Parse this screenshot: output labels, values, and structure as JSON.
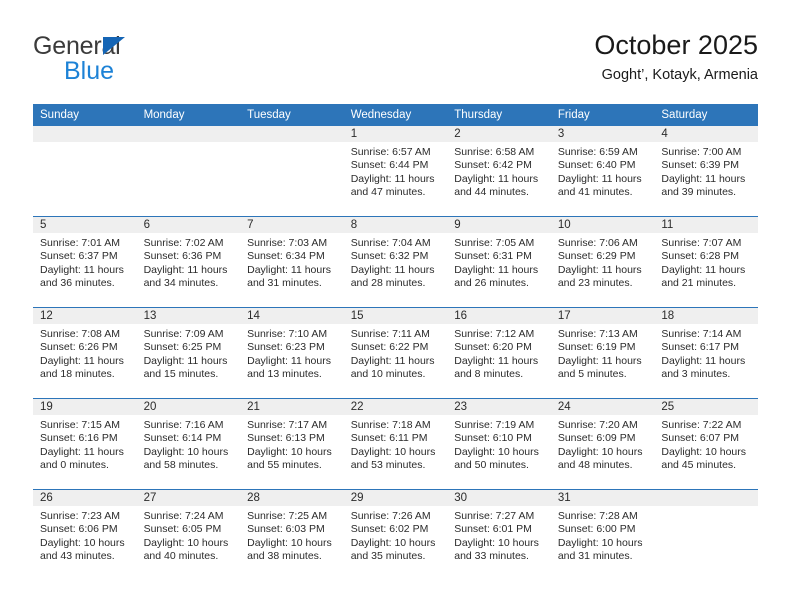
{
  "brand": {
    "line1": "General",
    "line2": "Blue",
    "triangle_color": "#1565b5",
    "blue_text_color": "#1d82d6"
  },
  "header": {
    "title": "October 2025",
    "subtitle": "Goght’, Kotayk, Armenia",
    "header_bg": "#2d75b9",
    "header_text": "#ffffff",
    "daynum_band": "#efefef"
  },
  "weekday_headers": [
    "Sunday",
    "Monday",
    "Tuesday",
    "Wednesday",
    "Thursday",
    "Friday",
    "Saturday"
  ],
  "weeks": [
    [
      {
        "day": "",
        "sunrise": "",
        "sunset": "",
        "daylight1": "",
        "daylight2": ""
      },
      {
        "day": "",
        "sunrise": "",
        "sunset": "",
        "daylight1": "",
        "daylight2": ""
      },
      {
        "day": "",
        "sunrise": "",
        "sunset": "",
        "daylight1": "",
        "daylight2": ""
      },
      {
        "day": "1",
        "sunrise": "Sunrise: 6:57 AM",
        "sunset": "Sunset: 6:44 PM",
        "daylight1": "Daylight: 11 hours",
        "daylight2": "and 47 minutes."
      },
      {
        "day": "2",
        "sunrise": "Sunrise: 6:58 AM",
        "sunset": "Sunset: 6:42 PM",
        "daylight1": "Daylight: 11 hours",
        "daylight2": "and 44 minutes."
      },
      {
        "day": "3",
        "sunrise": "Sunrise: 6:59 AM",
        "sunset": "Sunset: 6:40 PM",
        "daylight1": "Daylight: 11 hours",
        "daylight2": "and 41 minutes."
      },
      {
        "day": "4",
        "sunrise": "Sunrise: 7:00 AM",
        "sunset": "Sunset: 6:39 PM",
        "daylight1": "Daylight: 11 hours",
        "daylight2": "and 39 minutes."
      }
    ],
    [
      {
        "day": "5",
        "sunrise": "Sunrise: 7:01 AM",
        "sunset": "Sunset: 6:37 PM",
        "daylight1": "Daylight: 11 hours",
        "daylight2": "and 36 minutes."
      },
      {
        "day": "6",
        "sunrise": "Sunrise: 7:02 AM",
        "sunset": "Sunset: 6:36 PM",
        "daylight1": "Daylight: 11 hours",
        "daylight2": "and 34 minutes."
      },
      {
        "day": "7",
        "sunrise": "Sunrise: 7:03 AM",
        "sunset": "Sunset: 6:34 PM",
        "daylight1": "Daylight: 11 hours",
        "daylight2": "and 31 minutes."
      },
      {
        "day": "8",
        "sunrise": "Sunrise: 7:04 AM",
        "sunset": "Sunset: 6:32 PM",
        "daylight1": "Daylight: 11 hours",
        "daylight2": "and 28 minutes."
      },
      {
        "day": "9",
        "sunrise": "Sunrise: 7:05 AM",
        "sunset": "Sunset: 6:31 PM",
        "daylight1": "Daylight: 11 hours",
        "daylight2": "and 26 minutes."
      },
      {
        "day": "10",
        "sunrise": "Sunrise: 7:06 AM",
        "sunset": "Sunset: 6:29 PM",
        "daylight1": "Daylight: 11 hours",
        "daylight2": "and 23 minutes."
      },
      {
        "day": "11",
        "sunrise": "Sunrise: 7:07 AM",
        "sunset": "Sunset: 6:28 PM",
        "daylight1": "Daylight: 11 hours",
        "daylight2": "and 21 minutes."
      }
    ],
    [
      {
        "day": "12",
        "sunrise": "Sunrise: 7:08 AM",
        "sunset": "Sunset: 6:26 PM",
        "daylight1": "Daylight: 11 hours",
        "daylight2": "and 18 minutes."
      },
      {
        "day": "13",
        "sunrise": "Sunrise: 7:09 AM",
        "sunset": "Sunset: 6:25 PM",
        "daylight1": "Daylight: 11 hours",
        "daylight2": "and 15 minutes."
      },
      {
        "day": "14",
        "sunrise": "Sunrise: 7:10 AM",
        "sunset": "Sunset: 6:23 PM",
        "daylight1": "Daylight: 11 hours",
        "daylight2": "and 13 minutes."
      },
      {
        "day": "15",
        "sunrise": "Sunrise: 7:11 AM",
        "sunset": "Sunset: 6:22 PM",
        "daylight1": "Daylight: 11 hours",
        "daylight2": "and 10 minutes."
      },
      {
        "day": "16",
        "sunrise": "Sunrise: 7:12 AM",
        "sunset": "Sunset: 6:20 PM",
        "daylight1": "Daylight: 11 hours",
        "daylight2": "and 8 minutes."
      },
      {
        "day": "17",
        "sunrise": "Sunrise: 7:13 AM",
        "sunset": "Sunset: 6:19 PM",
        "daylight1": "Daylight: 11 hours",
        "daylight2": "and 5 minutes."
      },
      {
        "day": "18",
        "sunrise": "Sunrise: 7:14 AM",
        "sunset": "Sunset: 6:17 PM",
        "daylight1": "Daylight: 11 hours",
        "daylight2": "and 3 minutes."
      }
    ],
    [
      {
        "day": "19",
        "sunrise": "Sunrise: 7:15 AM",
        "sunset": "Sunset: 6:16 PM",
        "daylight1": "Daylight: 11 hours",
        "daylight2": "and 0 minutes."
      },
      {
        "day": "20",
        "sunrise": "Sunrise: 7:16 AM",
        "sunset": "Sunset: 6:14 PM",
        "daylight1": "Daylight: 10 hours",
        "daylight2": "and 58 minutes."
      },
      {
        "day": "21",
        "sunrise": "Sunrise: 7:17 AM",
        "sunset": "Sunset: 6:13 PM",
        "daylight1": "Daylight: 10 hours",
        "daylight2": "and 55 minutes."
      },
      {
        "day": "22",
        "sunrise": "Sunrise: 7:18 AM",
        "sunset": "Sunset: 6:11 PM",
        "daylight1": "Daylight: 10 hours",
        "daylight2": "and 53 minutes."
      },
      {
        "day": "23",
        "sunrise": "Sunrise: 7:19 AM",
        "sunset": "Sunset: 6:10 PM",
        "daylight1": "Daylight: 10 hours",
        "daylight2": "and 50 minutes."
      },
      {
        "day": "24",
        "sunrise": "Sunrise: 7:20 AM",
        "sunset": "Sunset: 6:09 PM",
        "daylight1": "Daylight: 10 hours",
        "daylight2": "and 48 minutes."
      },
      {
        "day": "25",
        "sunrise": "Sunrise: 7:22 AM",
        "sunset": "Sunset: 6:07 PM",
        "daylight1": "Daylight: 10 hours",
        "daylight2": "and 45 minutes."
      }
    ],
    [
      {
        "day": "26",
        "sunrise": "Sunrise: 7:23 AM",
        "sunset": "Sunset: 6:06 PM",
        "daylight1": "Daylight: 10 hours",
        "daylight2": "and 43 minutes."
      },
      {
        "day": "27",
        "sunrise": "Sunrise: 7:24 AM",
        "sunset": "Sunset: 6:05 PM",
        "daylight1": "Daylight: 10 hours",
        "daylight2": "and 40 minutes."
      },
      {
        "day": "28",
        "sunrise": "Sunrise: 7:25 AM",
        "sunset": "Sunset: 6:03 PM",
        "daylight1": "Daylight: 10 hours",
        "daylight2": "and 38 minutes."
      },
      {
        "day": "29",
        "sunrise": "Sunrise: 7:26 AM",
        "sunset": "Sunset: 6:02 PM",
        "daylight1": "Daylight: 10 hours",
        "daylight2": "and 35 minutes."
      },
      {
        "day": "30",
        "sunrise": "Sunrise: 7:27 AM",
        "sunset": "Sunset: 6:01 PM",
        "daylight1": "Daylight: 10 hours",
        "daylight2": "and 33 minutes."
      },
      {
        "day": "31",
        "sunrise": "Sunrise: 7:28 AM",
        "sunset": "Sunset: 6:00 PM",
        "daylight1": "Daylight: 10 hours",
        "daylight2": "and 31 minutes."
      },
      {
        "day": "",
        "sunrise": "",
        "sunset": "",
        "daylight1": "",
        "daylight2": ""
      }
    ]
  ]
}
